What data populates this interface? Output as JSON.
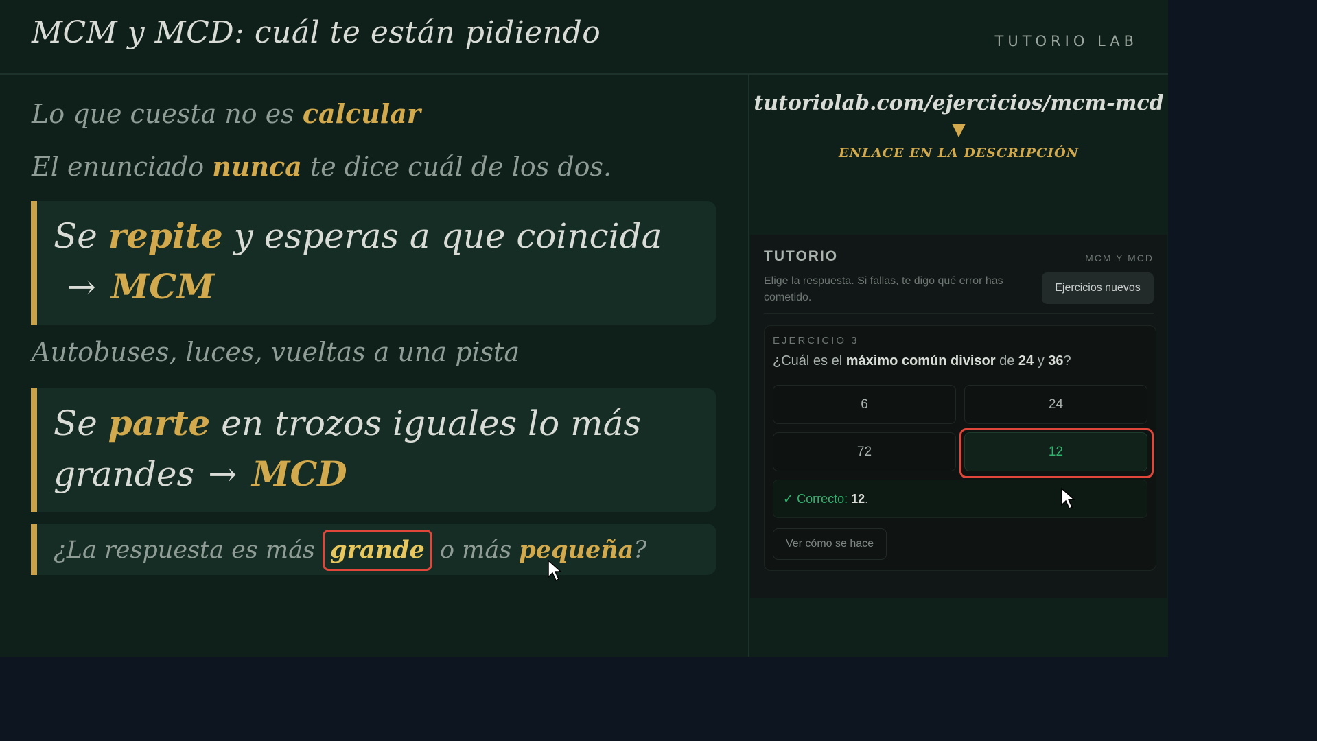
{
  "header": {
    "title": "MCM y MCD: cuál te están pidiendo",
    "brand": "TUTORIO LAB"
  },
  "left": {
    "line1": {
      "pre": "Lo que cuesta no es ",
      "accent": "calcular"
    },
    "line2": {
      "pre": "El enunciado ",
      "accent": "nunca",
      "post": " te dice cuál de los dos."
    },
    "box1": {
      "pre": "Se ",
      "accent": "repite",
      "post": " y esperas a que coincida",
      "arrow": "→",
      "result": "MCM"
    },
    "line3": "Autobuses, luces, vueltas a una pista",
    "box2": {
      "pre": "Se ",
      "accent": "parte",
      "post1": " en trozos iguales lo más",
      "post2": "grandes",
      "arrow": "→",
      "result": "MCD"
    },
    "box3": {
      "pre": "¿La respuesta es más ",
      "accent1": "grande",
      "mid": " o más ",
      "accent2": "pequeña",
      "post": "?"
    }
  },
  "link": {
    "url": "tutoriolab.com/ejercicios/mcm-mcd",
    "arrow": "▼",
    "note": "ENLACE EN LA DESCRIPCIÓN"
  },
  "panel": {
    "title": "TUTORIO",
    "topic": "MCM Y MCD",
    "description": "Elige la respuesta. Si fallas, te digo qué error has cometido.",
    "new_button": "Ejercicios nuevos",
    "exercise_label": "EJERCICIO 3",
    "question": {
      "pre": "¿Cuál es el ",
      "bold1": "máximo común divisor",
      "mid": " de ",
      "bold2": "24",
      "and": " y ",
      "bold3": "36",
      "post": "?"
    },
    "options": [
      "6",
      "24",
      "72",
      "12"
    ],
    "selected_option": "12",
    "feedback": {
      "check": "✓",
      "label": "Correcto:",
      "value": "12",
      "end": "."
    },
    "how_button": "Ver cómo se hace"
  },
  "colors": {
    "accent": "#d2a94c",
    "correct": "#2fb36e",
    "highlight_ring": "#e0473a",
    "background": "#0f201b"
  }
}
